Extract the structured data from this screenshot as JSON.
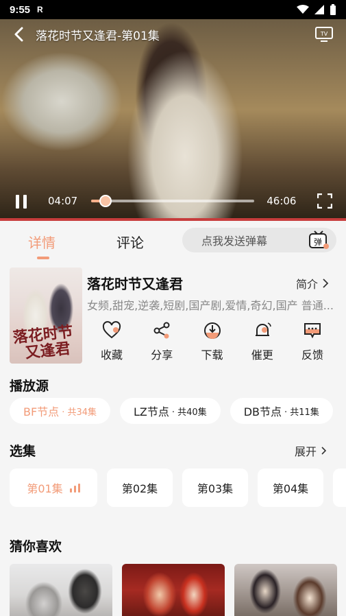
{
  "status_bar": {
    "time": "9:55",
    "r_indicator": "R"
  },
  "player": {
    "title": "落花时节又逢君-第01集",
    "current_time": "04:07",
    "duration": "46:06",
    "progress": 0.089
  },
  "tabs": {
    "detail": "详情",
    "comment": "评论",
    "danmu_placeholder": "点我发送弹幕",
    "danmu_icon_text": "弹"
  },
  "show": {
    "poster_text": "落花时节又逢君",
    "title": "落花时节又逢君",
    "synopsis_label": "简介",
    "tags": "女频,甜宠,逆袭,短剧,国产剧,爱情,奇幻,国产 普通..."
  },
  "actions": [
    {
      "label": "收藏",
      "icon": "heart-icon"
    },
    {
      "label": "分享",
      "icon": "share-icon"
    },
    {
      "label": "下载",
      "icon": "download-icon"
    },
    {
      "label": "催更",
      "icon": "bell-icon"
    },
    {
      "label": "反馈",
      "icon": "feedback-icon"
    }
  ],
  "sources_section": {
    "title": "播放源",
    "items": [
      {
        "name": "BF节点",
        "count": "· 共34集"
      },
      {
        "name": "LZ节点",
        "count": "· 共40集"
      },
      {
        "name": "DB节点",
        "count": "· 共11集"
      }
    ]
  },
  "episodes_section": {
    "title": "选集",
    "expand_label": "展开",
    "items": [
      "第01集",
      "第02集",
      "第03集",
      "第04集"
    ]
  },
  "recommend_section": {
    "title": "猜你喜欢"
  },
  "colors": {
    "accent": "#f29b78",
    "background": "#f5f5f5"
  }
}
